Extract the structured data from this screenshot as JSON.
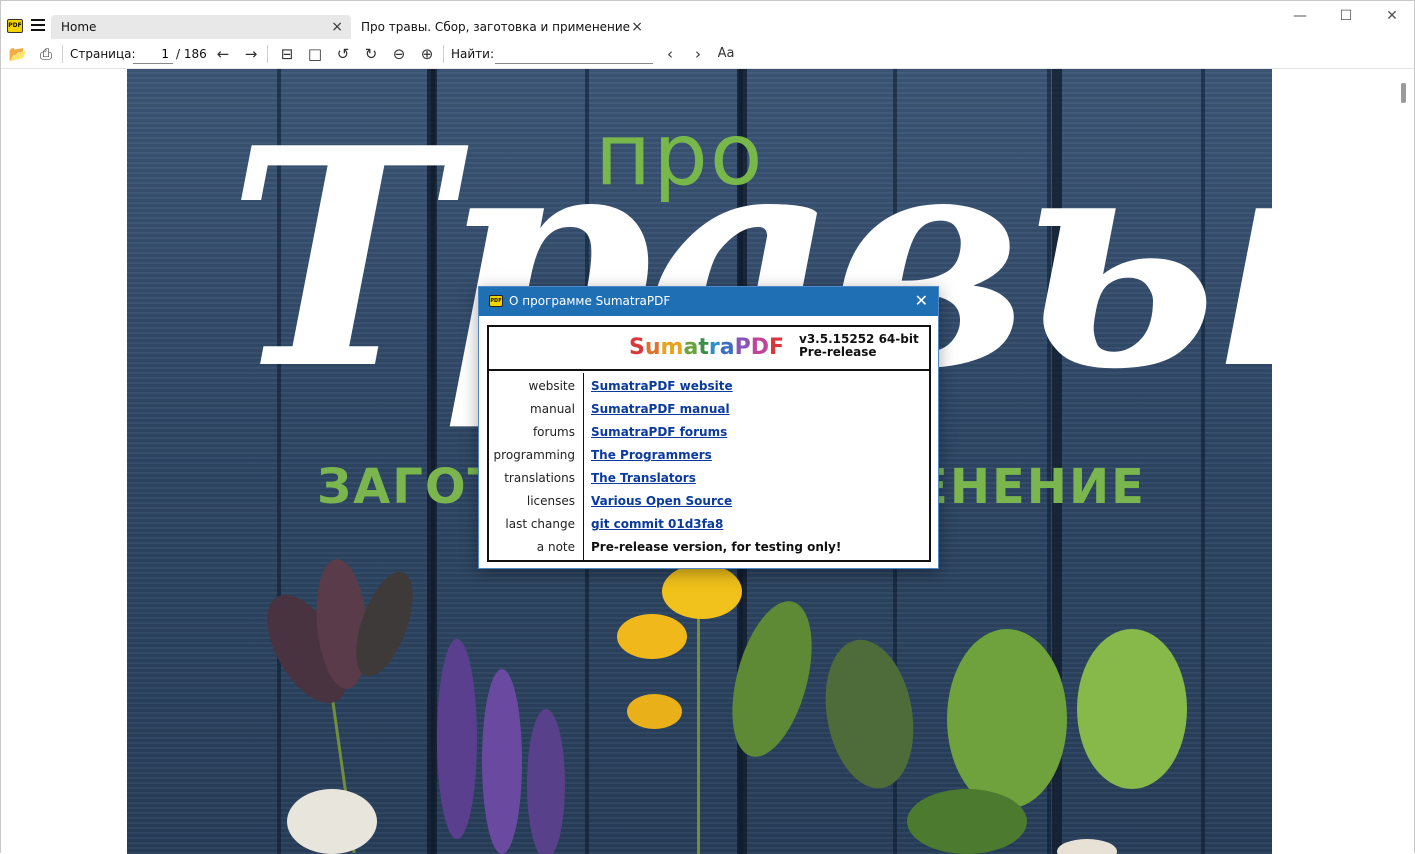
{
  "app": {
    "icon_text": "PDF"
  },
  "tabs": [
    {
      "label": "Home",
      "close": "×"
    },
    {
      "label": "Про травы. Сбор, заготовка и применение. Бо...",
      "close": "×"
    }
  ],
  "window_controls": {
    "minimize": "—",
    "maximize": "☐",
    "close": "✕"
  },
  "toolbar": {
    "page_label": "Страница:",
    "page_value": "1",
    "page_total": "/ 186",
    "find_label": "Найти:",
    "find_value": "",
    "icons": {
      "open": "📂",
      "print": "⎙",
      "prev_page": "←",
      "next_page": "→",
      "layout_continuous": "⊟",
      "layout_single": "□",
      "rotate_left": "↺",
      "rotate_right": "↻",
      "zoom_out": "⊖",
      "zoom_in": "⊕",
      "find_prev": "‹",
      "find_next": "›",
      "match_case": "Aa"
    }
  },
  "cover": {
    "pro": "про",
    "title": "Травы",
    "subtitle": "ЗАГОТОВКА И ПРИМЕНЕНИЕ"
  },
  "dialog": {
    "title": "О программе SumatraPDF",
    "close": "✕",
    "logo_letters": [
      {
        "ch": "S",
        "color": "#d9383a"
      },
      {
        "ch": "u",
        "color": "#e0702a"
      },
      {
        "ch": "m",
        "color": "#e9a21e"
      },
      {
        "ch": "a",
        "color": "#6aa33b"
      },
      {
        "ch": "t",
        "color": "#3c8e4a"
      },
      {
        "ch": "r",
        "color": "#2f8fc2"
      },
      {
        "ch": "a",
        "color": "#3d6fc0"
      },
      {
        "ch": "P",
        "color": "#8a55b8"
      },
      {
        "ch": "D",
        "color": "#c2439a"
      },
      {
        "ch": "F",
        "color": "#d9383a"
      }
    ],
    "version_line1": "v3.5.15252 64-bit",
    "version_line2": "Pre-release",
    "rows": [
      {
        "label": "website",
        "value": "SumatraPDF website",
        "link": true
      },
      {
        "label": "manual",
        "value": "SumatraPDF manual",
        "link": true
      },
      {
        "label": "forums",
        "value": "SumatraPDF forums",
        "link": true
      },
      {
        "label": "programming",
        "value": "The Programmers",
        "link": true
      },
      {
        "label": "translations",
        "value": "The Translators",
        "link": true
      },
      {
        "label": "licenses",
        "value": "Various Open Source",
        "link": true
      },
      {
        "label": "last change",
        "value": "git commit 01d3fa8",
        "link": true
      },
      {
        "label": "a note",
        "value": "Pre-release version, for testing only!",
        "link": false
      }
    ]
  }
}
